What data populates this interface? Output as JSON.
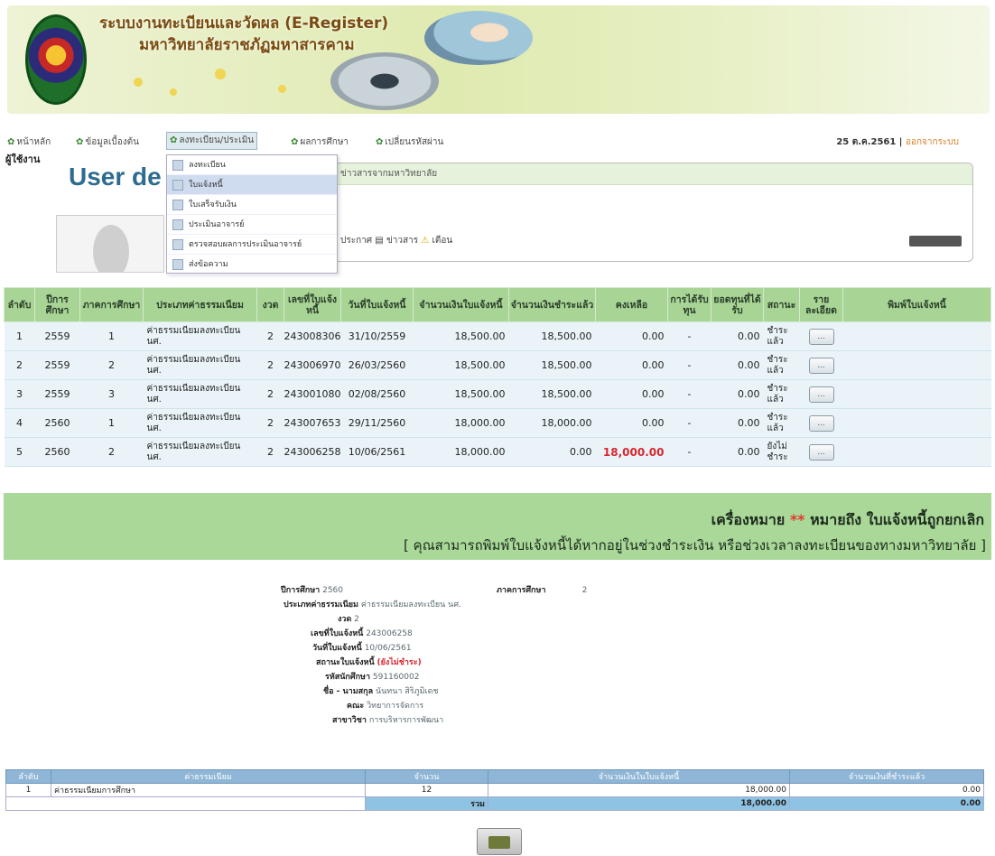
{
  "header": {
    "title_line1": "ระบบงานทะเบียนและวัดผล (E-Register)",
    "title_line2": "มหาวิทยาลัยราชภัฏมหาสารคาม"
  },
  "menu": {
    "items": [
      {
        "label": "หน้าหลัก"
      },
      {
        "label": "ข้อมูลเบื้องต้น"
      },
      {
        "label": "ลงทะเบียน/ประเมิน"
      },
      {
        "label": "ผลการศึกษา"
      },
      {
        "label": "เปลี่ยนรหัสผ่าน"
      }
    ],
    "date": "25 ต.ค.2561",
    "logout": "ออกจากระบบ"
  },
  "dropdown": {
    "items": [
      {
        "label": "ลงทะเบียน"
      },
      {
        "label": "ใบแจ้งหนี้"
      },
      {
        "label": "ใบเสร็จรับเงิน"
      },
      {
        "label": "ประเมินอาจารย์"
      },
      {
        "label": "ตรวจสอบผลการประเมินอาจารย์"
      },
      {
        "label": "ส่งข้อความ"
      }
    ]
  },
  "user": {
    "label": "ผู้ใช้งาน",
    "heading": "User de"
  },
  "info_panel": {
    "header": "ข่าวสารจากมหาวิทยาลัย",
    "announce": "ประกาศ",
    "news": "ข่าวสาร",
    "warn": "เตือน"
  },
  "table": {
    "headers": [
      "ลำดับ",
      "ปีการศึกษา",
      "ภาคการศึกษา",
      "ประเภทค่าธรรมเนียม",
      "งวด",
      "เลขที่ใบแจ้งหนี้",
      "วันที่ใบแจ้งหนี้",
      "จำนวนเงินใบแจ้งหนี้",
      "จำนวนเงินชำระแล้ว",
      "คงเหลือ",
      "การได้รับทุน",
      "ยอดทุนที่ได้รับ",
      "สถานะ",
      "รายละเอียด",
      "พิมพ์ใบแจ้งหนี้"
    ],
    "rows": [
      {
        "no": "1",
        "year": "2559",
        "term": "1",
        "type": "ค่าธรรมเนียมลงทะเบียน นศ.",
        "period": "2",
        "invoice": "243008306",
        "date": "31/10/2559",
        "amount": "18,500.00",
        "paid": "18,500.00",
        "balance": "0.00",
        "scholar": "-",
        "scholar_amt": "0.00",
        "status": "ชำระแล้ว",
        "detail": "..."
      },
      {
        "no": "2",
        "year": "2559",
        "term": "2",
        "type": "ค่าธรรมเนียมลงทะเบียน นศ.",
        "period": "2",
        "invoice": "243006970",
        "date": "26/03/2560",
        "amount": "18,500.00",
        "paid": "18,500.00",
        "balance": "0.00",
        "scholar": "-",
        "scholar_amt": "0.00",
        "status": "ชำระแล้ว",
        "detail": "..."
      },
      {
        "no": "3",
        "year": "2559",
        "term": "3",
        "type": "ค่าธรรมเนียมลงทะเบียน นศ.",
        "period": "2",
        "invoice": "243001080",
        "date": "02/08/2560",
        "amount": "18,500.00",
        "paid": "18,500.00",
        "balance": "0.00",
        "scholar": "-",
        "scholar_amt": "0.00",
        "status": "ชำระแล้ว",
        "detail": "..."
      },
      {
        "no": "4",
        "year": "2560",
        "term": "1",
        "type": "ค่าธรรมเนียมลงทะเบียน นศ.",
        "period": "2",
        "invoice": "243007653",
        "date": "29/11/2560",
        "amount": "18,000.00",
        "paid": "18,000.00",
        "balance": "0.00",
        "scholar": "-",
        "scholar_amt": "0.00",
        "status": "ชำระแล้ว",
        "detail": "..."
      },
      {
        "no": "5",
        "year": "2560",
        "term": "2",
        "type": "ค่าธรรมเนียมลงทะเบียน นศ.",
        "period": "2",
        "invoice": "243006258",
        "date": "10/06/2561",
        "amount": "18,000.00",
        "paid": "0.00",
        "balance": "18,000.00",
        "scholar": "-",
        "scholar_amt": "0.00",
        "status": "ยังไม่ชำระ",
        "detail": "..."
      }
    ]
  },
  "note": {
    "prefix": "เครื่องหมาย",
    "stars": "**",
    "suffix": "หมายถึง ใบแจ้งหนี้ถูกยกเลิก",
    "line2": "[ คุณสามารถพิมพ์ใบแจ้งหนี้ได้หากอยู่ในช่วงชำระเงิน หรือช่วงเวลาลงทะเบียนของทางมหาวิทยาลัย ]"
  },
  "detail": {
    "year_label": "ปีการศึกษา",
    "year": "2560",
    "term_label": "ภาคการศึกษา",
    "term": "2",
    "type_label": "ประเภทค่าธรรมเนียม",
    "type": "ค่าธรรมเนียมลงทะเบียน นศ.",
    "period_label": "งวด",
    "period": "2",
    "invoice_label": "เลขที่ใบแจ้งหนี้",
    "invoice": "243006258",
    "date_label": "วันที่ใบแจ้งหนี้",
    "date": "10/06/2561",
    "status_label": "สถานะใบแจ้งหนี้",
    "status": "(ยังไม่ชำระ)",
    "sid_label": "รหัสนักศึกษา",
    "sid": "591160002",
    "name_label": "ชื่อ - นามสกุล",
    "name": "นันทนา สิริภูมิเดช",
    "faculty_label": "คณะ",
    "faculty": "วิทยาการจัดการ",
    "major_label": "สาขาวิชา",
    "major": "การบริหารการพัฒนา"
  },
  "subtable": {
    "headers": [
      "ลำดับ",
      "ค่าธรรมเนียม",
      "จำนวน",
      "จำนวนเงินในใบแจ้งหนี้",
      "จำนวนเงินที่ชำระแล้ว"
    ],
    "row": {
      "no": "1",
      "name": "ค่าธรรมเนียมการศึกษา",
      "qty": "12",
      "amount": "18,000.00",
      "paid": "0.00"
    },
    "total_label": "รวม",
    "total_amount": "18,000.00",
    "total_paid": "0.00"
  }
}
